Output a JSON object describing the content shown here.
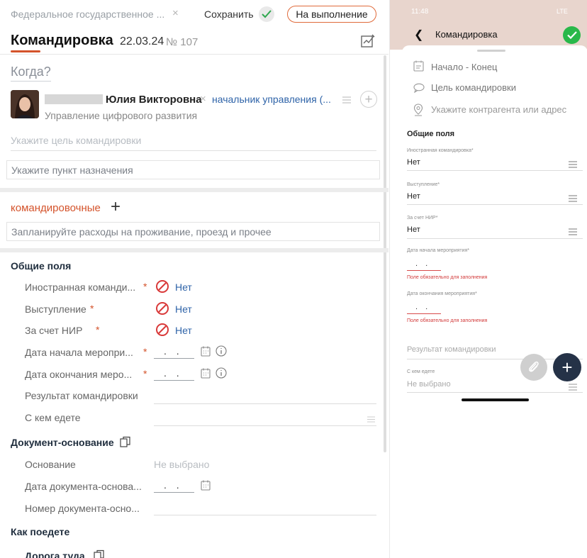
{
  "left": {
    "topbar": {
      "org": "Федеральное государственное ...",
      "save_label": "Сохранить",
      "exec_label": "На выполнение"
    },
    "header": {
      "title": "Командировка",
      "date": "22.03.24",
      "number": "№ 107"
    },
    "when_label": "Когда?",
    "person": {
      "name": "Юлия Викторовна",
      "position": "начальник управления (...",
      "department": "Управление цифрового развития"
    },
    "goal_placeholder": "Укажите цель командировки",
    "destination_placeholder": "Укажите пункт назначения",
    "trip_expenses": {
      "label": "командировочные",
      "placeholder": "Запланируйте расходы на проживание, проезд и прочее"
    },
    "common": {
      "title": "Общие поля",
      "foreign_label": "Иностранная команди...",
      "foreign_value": "Нет",
      "speech_label": "Выступление",
      "speech_value": "Нет",
      "nir_label": "За счет НИР",
      "nir_value": "Нет",
      "event_start_label": "Дата начала меропри...",
      "event_start_value": ". .",
      "event_end_label": "Дата окончания меро...",
      "event_end_value": ". .",
      "result_label": "Результат командировки",
      "with_whom_label": "С кем едете",
      "required_mark": "*"
    },
    "basis": {
      "title": "Документ-основание",
      "basis_label": "Основание",
      "basis_value": "Не выбрано",
      "doc_date_label": "Дата документа-основа...",
      "doc_date_value": ". .",
      "doc_number_label": "Номер документа-осно..."
    },
    "travel": {
      "title": "Как поедете",
      "road_there": "Дорога туда"
    }
  },
  "right": {
    "status_time": "11:48",
    "status_right": "LTE",
    "nav_title": "Командировка",
    "rows": {
      "period": "Начало - Конец",
      "goal": "Цель командировки",
      "contractor": "Укажите контрагента или адрес"
    },
    "common_title": "Общие поля",
    "foreign_label": "Иностранная командировка*",
    "foreign_value": "Нет",
    "speech_label": "Выступление*",
    "speech_value": "Нет",
    "nir_label": "За счет НИР*",
    "nir_value": "Нет",
    "event_start_label": "Дата начала мероприятия*",
    "event_start_value": ". .",
    "event_start_error": "Поле обязательно для заполнения",
    "event_end_label": "Дата окончания мероприятия*",
    "event_end_value": ". .",
    "event_end_error": "Поле обязательно для заполнения",
    "result_placeholder": "Результат командировки",
    "with_whom_label": "С кем едете",
    "with_whom_value": "Не выбрано"
  },
  "colors": {
    "accent": "#d4532b",
    "link": "#2e63a8",
    "success": "#29b84a",
    "nav_bg": "#e8d5cd",
    "fab": "#253247"
  }
}
